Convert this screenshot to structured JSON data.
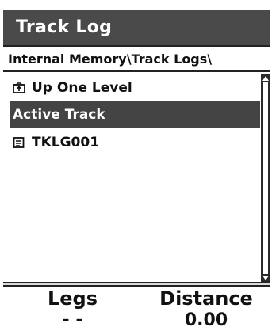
{
  "header": {
    "title": "Track Log"
  },
  "path": {
    "text": "Internal Memory\\Track Logs\\"
  },
  "list": {
    "items": [
      {
        "label": "Up One Level",
        "icon": "folder-up-icon"
      },
      {
        "label": "Active Track",
        "icon": null
      },
      {
        "label": "TKLG001",
        "icon": "document-icon"
      }
    ]
  },
  "stats": {
    "legs_label": "Legs",
    "legs_value": "- -",
    "distance_label": "Distance",
    "distance_value": "0.00"
  }
}
